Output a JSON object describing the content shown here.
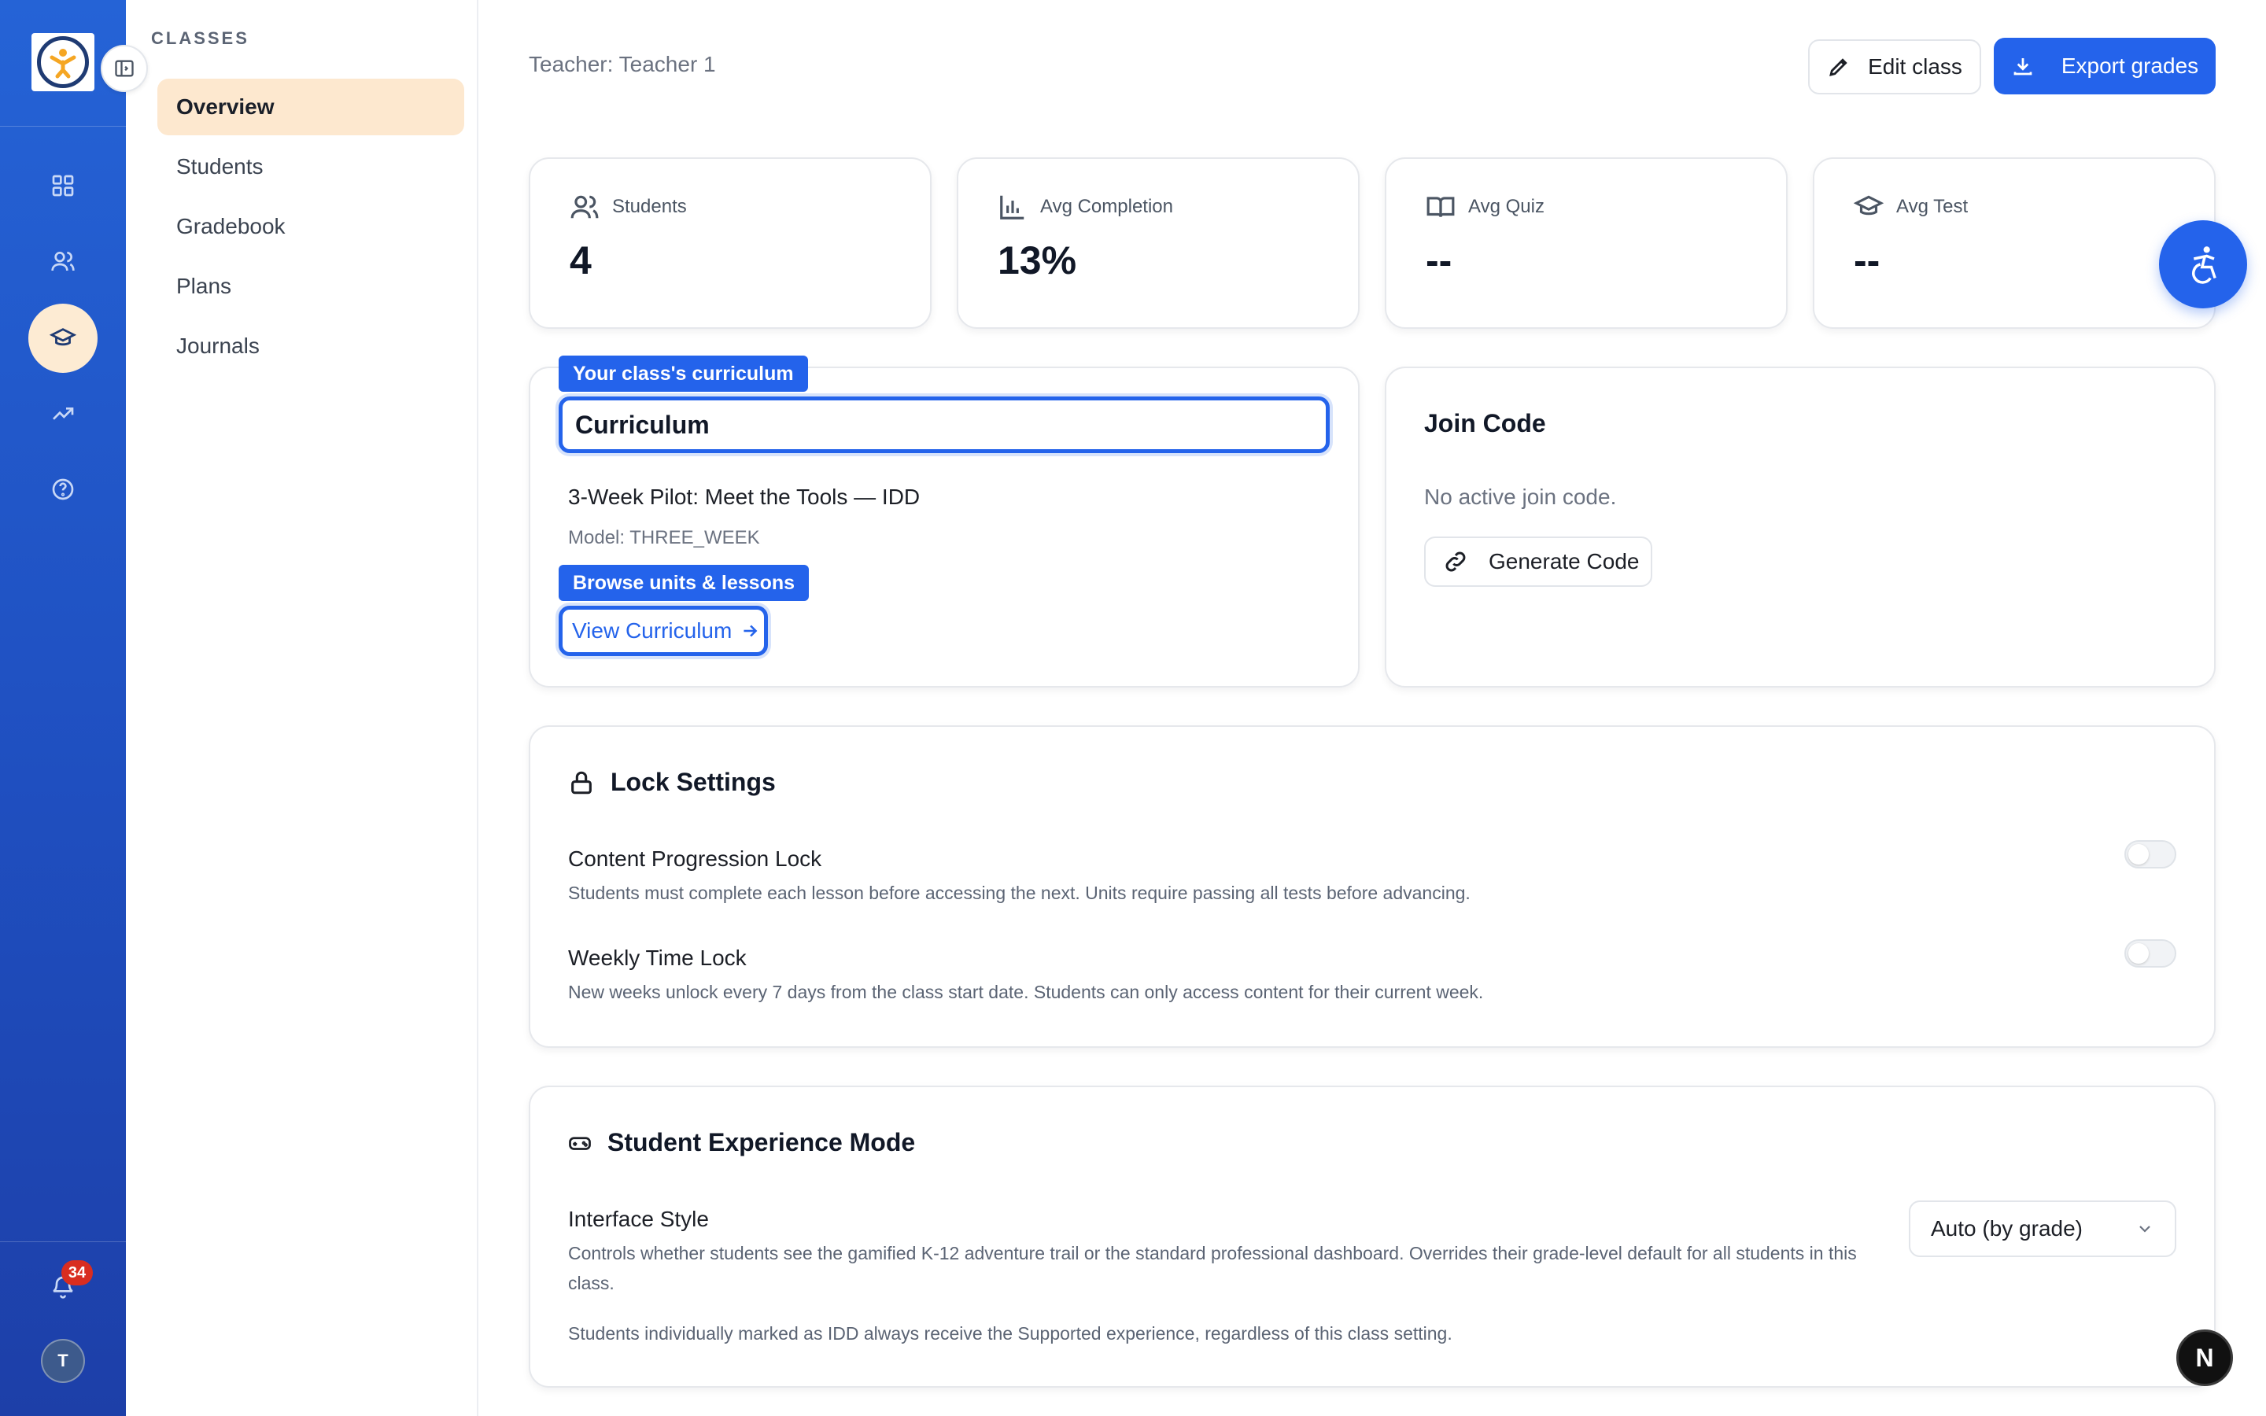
{
  "sidebar": {
    "section_title": "CLASSES",
    "items": [
      {
        "label": "Overview",
        "active": true
      },
      {
        "label": "Students"
      },
      {
        "label": "Gradebook"
      },
      {
        "label": "Plans"
      },
      {
        "label": "Journals"
      }
    ],
    "rail_icons": [
      "dashboard-icon",
      "users-icon",
      "graduation-cap-icon",
      "trending-up-icon",
      "help-circle-icon",
      "bell-icon"
    ],
    "notification_count": "34",
    "avatar_initial": "T"
  },
  "header": {
    "teacher": "Teacher: Teacher 1",
    "edit_label": "Edit class",
    "export_label": "Export grades"
  },
  "stats": [
    {
      "label": "Students",
      "value": "4",
      "icon": "users-icon"
    },
    {
      "label": "Avg Completion",
      "value": "13%",
      "icon": "bar-chart-icon"
    },
    {
      "label": "Avg Quiz",
      "value": "--",
      "icon": "book-open-icon"
    },
    {
      "label": "Avg Test",
      "value": "--",
      "icon": "graduation-cap-icon"
    }
  ],
  "curriculum": {
    "tag": "Your class's curriculum",
    "title": "Curriculum",
    "name": "3-Week Pilot: Meet the Tools — IDD",
    "model": "Model: THREE_WEEK",
    "browse_tag": "Browse units & lessons",
    "view_label": "View Curriculum"
  },
  "join_code": {
    "title": "Join Code",
    "status": "No active join code.",
    "generate_label": "Generate Code"
  },
  "lock_settings": {
    "title": "Lock Settings",
    "items": [
      {
        "label": "Content Progression Lock",
        "desc": "Students must complete each lesson before accessing the next. Units require passing all tests before advancing.",
        "enabled": false
      },
      {
        "label": "Weekly Time Lock",
        "desc": "New weeks unlock every 7 days from the class start date. Students can only access content for their current week.",
        "enabled": false
      }
    ]
  },
  "experience": {
    "title": "Student Experience Mode",
    "interface_label": "Interface Style",
    "interface_desc": "Controls whether students see the gamified K-12 adventure trail or the standard professional dashboard. Overrides their grade-level default for all students in this class.",
    "note": "Students individually marked as IDD always receive the Supported experience, regardless of this class setting.",
    "selected": "Auto (by grade)"
  },
  "floating": {
    "next_badge": "N"
  },
  "colors": {
    "accent": "#2463eb",
    "rail": "#1f4fc0",
    "active_nav": "#fde8cf",
    "badge": "#d92d20"
  }
}
